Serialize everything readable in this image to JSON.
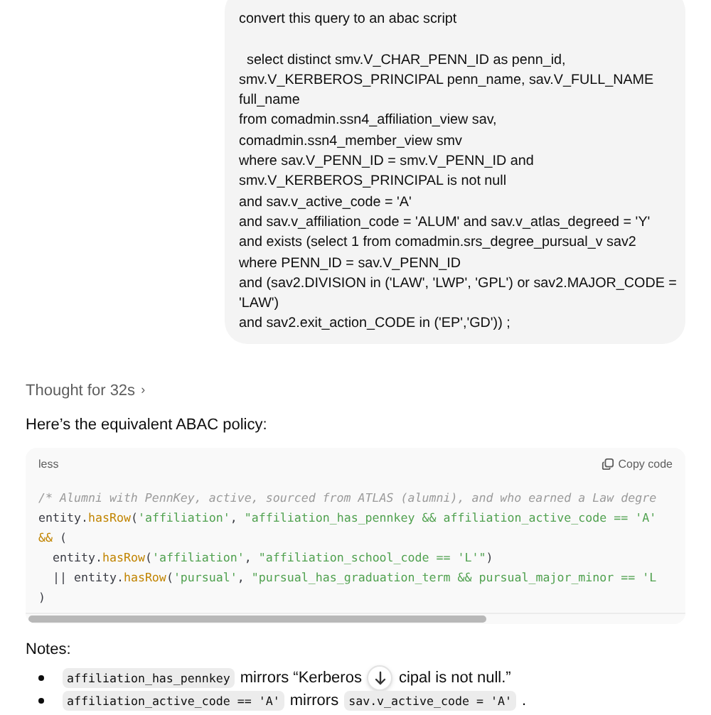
{
  "user_message": {
    "text": "convert this query to an abac script\n\n  select distinct smv.V_CHAR_PENN_ID as penn_id, smv.V_KERBEROS_PRINCIPAL penn_name, sav.V_FULL_NAME full_name\nfrom comadmin.ssn4_affiliation_view sav, comadmin.ssn4_member_view smv\nwhere sav.V_PENN_ID = smv.V_PENN_ID and smv.V_KERBEROS_PRINCIPAL is not null\nand sav.v_active_code = 'A'\nand sav.v_affiliation_code = 'ALUM' and sav.v_atlas_degreed = 'Y'\nand exists (select 1 from comadmin.srs_degree_pursual_v sav2\nwhere PENN_ID = sav.V_PENN_ID\nand (sav2.DIVISION in ('LAW', 'LWP', 'GPL') or sav2.MAJOR_CODE = 'LAW')\nand sav2.exit_action_CODE in ('EP','GD')) ;"
  },
  "thought": {
    "label": "Thought for 32s",
    "chevron": "›"
  },
  "intro": "Here’s the equivalent ABAC policy:",
  "code_block": {
    "language": "less",
    "copy_label": "Copy code",
    "lines": [
      [
        {
          "kind": "comment",
          "text": "/* Alumni with PennKey, active, sourced from ATLAS (alumni), and who earned a Law degre"
        }
      ],
      [
        {
          "kind": "plain",
          "text": "entity."
        },
        {
          "kind": "function",
          "text": "hasRow"
        },
        {
          "kind": "plain",
          "text": "("
        },
        {
          "kind": "string",
          "text": "'affiliation'"
        },
        {
          "kind": "plain",
          "text": ", "
        },
        {
          "kind": "string",
          "text": "\"affiliation_has_pennkey && affiliation_active_code == 'A'"
        }
      ],
      [
        {
          "kind": "operator",
          "text": "&&"
        },
        {
          "kind": "plain",
          "text": " ("
        }
      ],
      [
        {
          "kind": "plain",
          "text": "  entity."
        },
        {
          "kind": "function",
          "text": "hasRow"
        },
        {
          "kind": "plain",
          "text": "("
        },
        {
          "kind": "string",
          "text": "'affiliation'"
        },
        {
          "kind": "plain",
          "text": ", "
        },
        {
          "kind": "string",
          "text": "\"affiliation_school_code == 'L'\""
        },
        {
          "kind": "plain",
          "text": ")"
        }
      ],
      [
        {
          "kind": "plain",
          "text": "  || entity."
        },
        {
          "kind": "function",
          "text": "hasRow"
        },
        {
          "kind": "plain",
          "text": "("
        },
        {
          "kind": "string",
          "text": "'pursual'"
        },
        {
          "kind": "plain",
          "text": ", "
        },
        {
          "kind": "string",
          "text": "\"pursual_has_graduation_term && pursual_major_minor == 'L"
        }
      ],
      [
        {
          "kind": "plain",
          "text": ")"
        }
      ]
    ]
  },
  "notes": {
    "heading": "Notes:",
    "items": [
      [
        {
          "kind": "code",
          "text": "affiliation_has_pennkey"
        },
        {
          "kind": "text",
          "text": "mirrors “Kerberos"
        },
        {
          "kind": "scroll-button"
        },
        {
          "kind": "text",
          "text": "cipal is not null.”"
        }
      ],
      [
        {
          "kind": "code",
          "text": "affiliation_active_code == 'A'"
        },
        {
          "kind": "text",
          "text": "mirrors"
        },
        {
          "kind": "code",
          "text": "sav.v_active_code = 'A'"
        },
        {
          "kind": "text",
          "text": "."
        }
      ]
    ]
  }
}
